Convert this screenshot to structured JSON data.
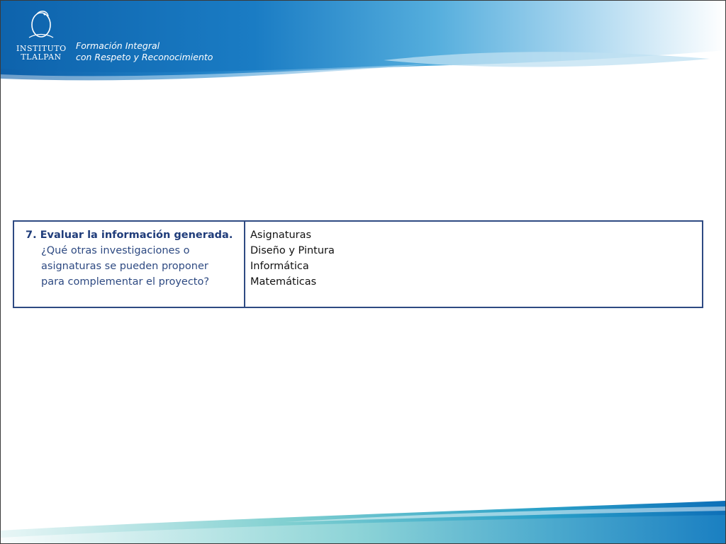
{
  "header": {
    "logo_line1": "INSTITUTO",
    "logo_line2": "TLALPAN",
    "tagline_line1": "Formación Integral",
    "tagline_line2": "con Respeto y Reconocimiento"
  },
  "table": {
    "step_title": "7. Evaluar la información generada.",
    "question_lines": [
      "¿Qué otras investigaciones o",
      "asignaturas se pueden  proponer",
      "para complementar el proyecto?"
    ],
    "subjects": [
      "Asignaturas",
      "Diseño y Pintura",
      "Informática",
      "Matemáticas"
    ]
  },
  "colors": {
    "brand_blue": "#1a73c0",
    "border_navy": "#2e4a82"
  }
}
